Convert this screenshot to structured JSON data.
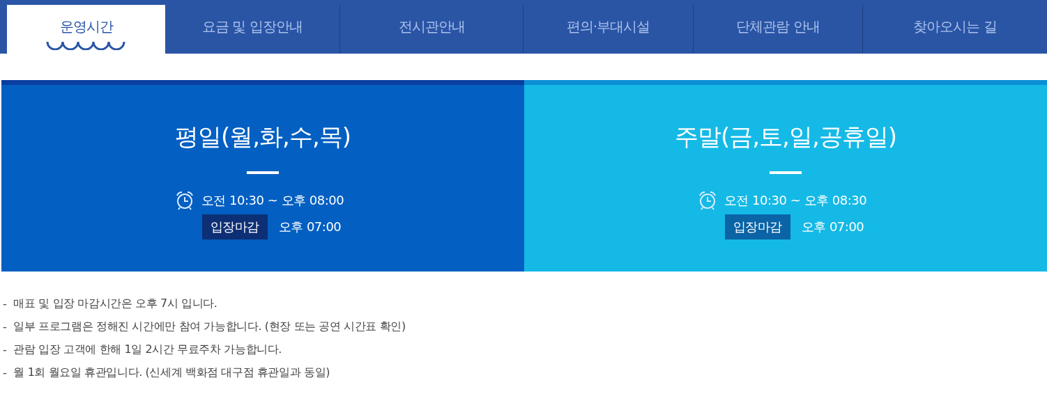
{
  "tabs": [
    {
      "label": "운영시간",
      "selected": true
    },
    {
      "label": "요금 및 입장안내",
      "selected": false
    },
    {
      "label": "전시관안내",
      "selected": false
    },
    {
      "label": "편의·부대시설",
      "selected": false
    },
    {
      "label": "단체관람 안내",
      "selected": false
    },
    {
      "label": "찾아오시는 길",
      "selected": false
    }
  ],
  "panels": [
    {
      "kind": "weekday",
      "title": "평일(월,화,수,목)",
      "hours": "오전 10:30 ~ 오후 08:00",
      "closing_label": "입장마감",
      "closing_time": "오후 07:00"
    },
    {
      "kind": "weekend",
      "title": "주말(금,토,일,공휴일)",
      "hours": "오전 10:30 ~ 오후 08:30",
      "closing_label": "입장마감",
      "closing_time": "오후 07:00"
    }
  ],
  "notes": [
    {
      "marker": "-",
      "text": "매표 및 입장 마감시간은 오후 7시 입니다."
    },
    {
      "marker": "-",
      "text": "일부 프로그램은 정해진 시간에만 참여 가능합니다. (현장 또는 공연 시간표 확인)"
    },
    {
      "marker": "-",
      "text": "관람 입장 고객에 한해 1일 2시간 무료주차 가능합니다."
    },
    {
      "marker": "-",
      "text": "월 1회 월요일 휴관입니다. (신세계 백화점 대구점 휴관일과 동일)"
    }
  ]
}
